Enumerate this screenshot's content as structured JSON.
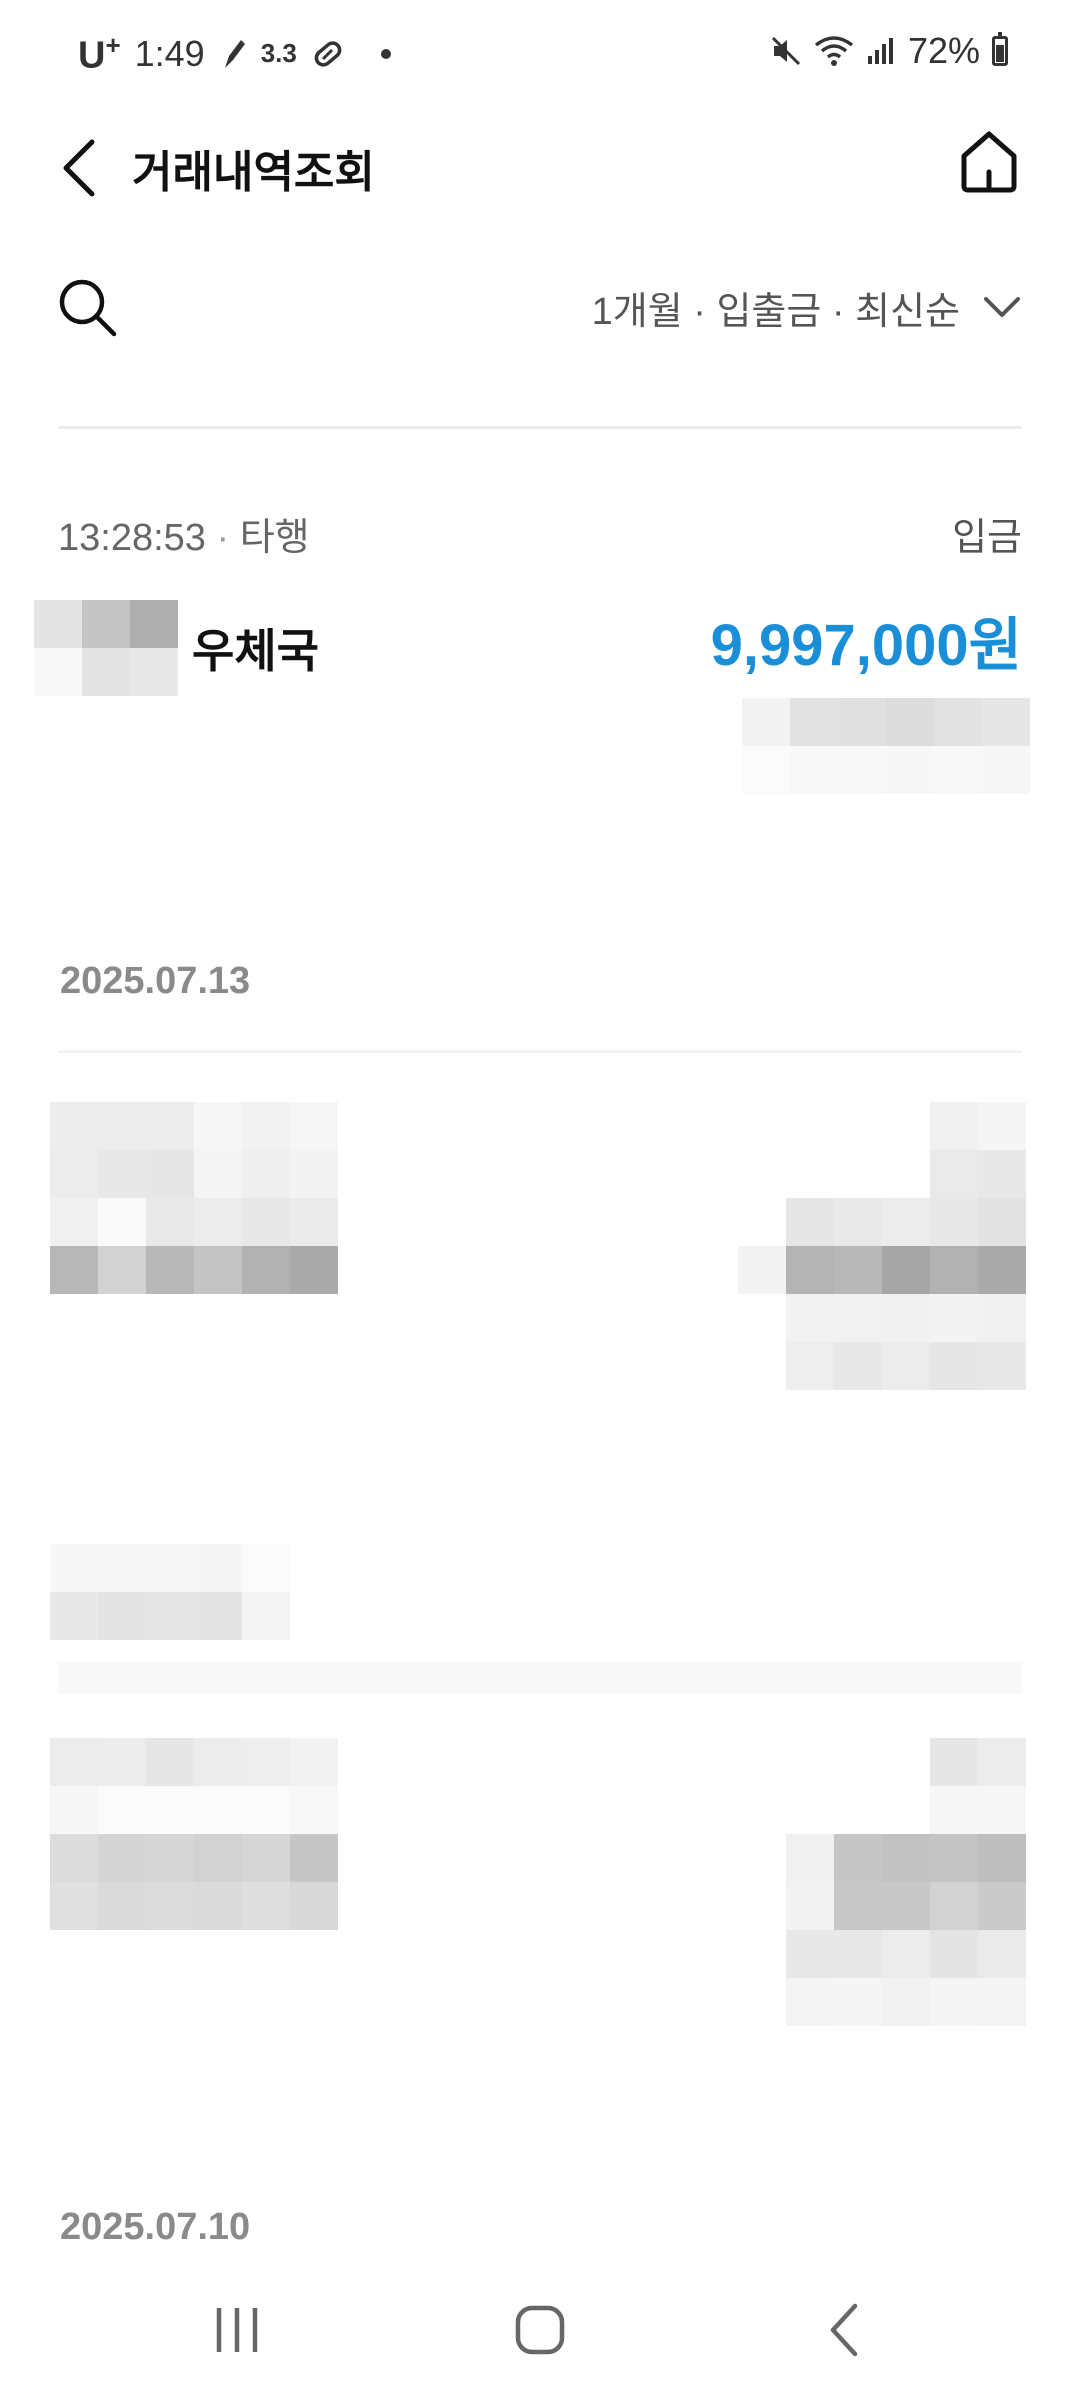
{
  "status_bar": {
    "carrier": "U",
    "carrier_sup": "+",
    "time": "1:49",
    "speed": "3.3",
    "battery": "72%"
  },
  "header": {
    "title": "거래내역조회"
  },
  "filter": {
    "summary": "1개월 · 입출금 · 최신순"
  },
  "transaction": {
    "time": "13:28:53",
    "separator": " · ",
    "bank_type": "타행",
    "type": "입금",
    "name": "우체국",
    "amount": "9,997,000원"
  },
  "date_groups": [
    {
      "date": "2025.07.13"
    },
    {
      "date": "2025.07.10"
    }
  ],
  "icons": {
    "back": "chevron-left-icon",
    "home": "home-icon",
    "search": "search-icon",
    "filter": "chevron-down-icon",
    "nav_recent": "recent-apps-icon",
    "nav_home": "nav-home-icon",
    "nav_back": "nav-back-icon"
  },
  "colors": {
    "amount": "#1a8fd8",
    "date_header": "#8a8a8a"
  }
}
